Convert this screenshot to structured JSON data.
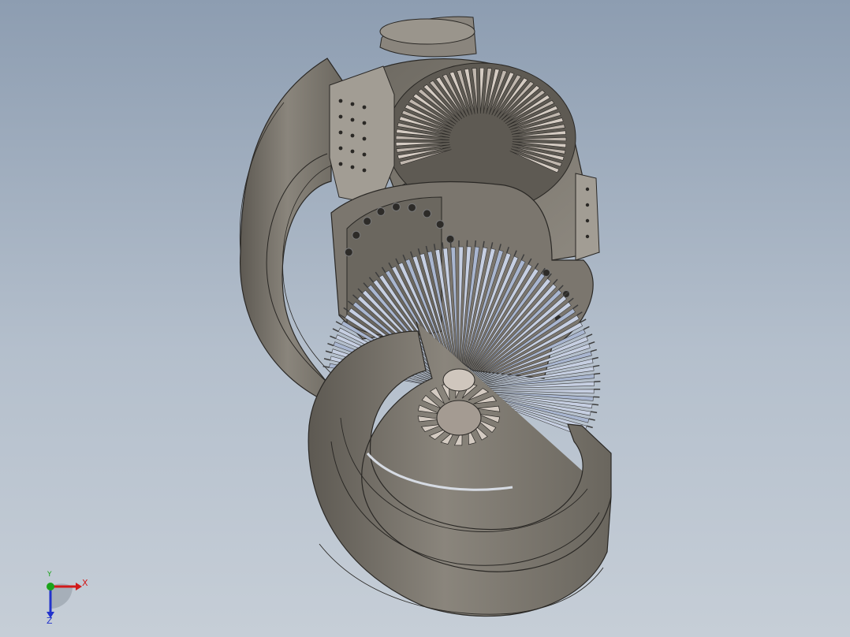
{
  "viewport": {
    "background_top": "#8d9db1",
    "background_bottom": "#c6ced7"
  },
  "model": {
    "body_color": "#7a756d",
    "body_light": "#8e8a82",
    "body_dark": "#5b5750",
    "edge_color": "#2a2825",
    "blade_light": "#d4cbc2",
    "blade_blue": "#a9b6d0",
    "blade_dark": "#3d3d3d"
  },
  "triad": {
    "x_label": "X",
    "y_label": "Y",
    "z_label": "Z",
    "x_color": "#d11a1a",
    "y_color": "#1aa31a",
    "z_color": "#2233cc"
  }
}
